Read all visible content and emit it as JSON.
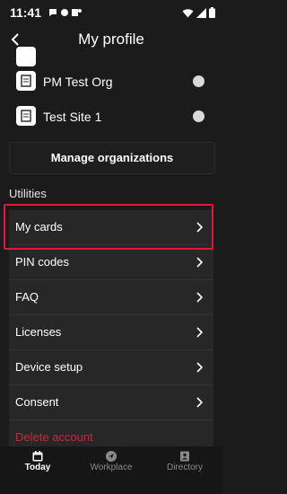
{
  "status": {
    "time": "11:41"
  },
  "header": {
    "title": "My profile"
  },
  "organizations": [
    {
      "label": "PM Test Org"
    },
    {
      "label": "Test Site 1"
    }
  ],
  "manage_button": "Manage organizations",
  "section_title": "Utilities",
  "utilities": [
    {
      "label": "My cards"
    },
    {
      "label": "PIN codes"
    },
    {
      "label": "FAQ"
    },
    {
      "label": "Licenses"
    },
    {
      "label": "Device setup"
    },
    {
      "label": "Consent"
    },
    {
      "label": "Delete account"
    }
  ],
  "bottom_nav": [
    {
      "label": "Today",
      "icon": "calendar-icon"
    },
    {
      "label": "Workplace",
      "icon": "location-arrow-icon"
    },
    {
      "label": "Directory",
      "icon": "contacts-book-icon"
    }
  ],
  "colors": {
    "highlight": "#e31837",
    "delete": "#c8283a",
    "background": "#1b1b1b"
  }
}
